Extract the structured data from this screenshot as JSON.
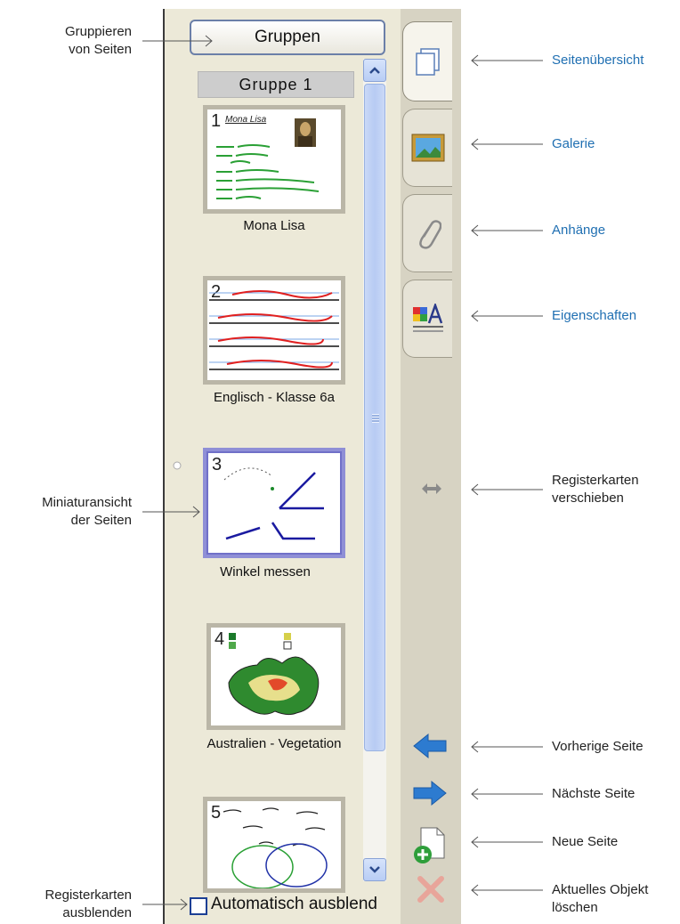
{
  "groups_button": {
    "label": "Gruppen"
  },
  "group_header": {
    "label": "Gruppe 1"
  },
  "pages": [
    {
      "number": "1",
      "title": "Mona Lisa",
      "heading": "Mona Lisa"
    },
    {
      "number": "2",
      "title": "Englisch - Klasse 6a"
    },
    {
      "number": "3",
      "title": "Winkel messen"
    },
    {
      "number": "4",
      "title": "Australien - Vegetation"
    },
    {
      "number": "5",
      "title": ""
    }
  ],
  "tabs": [
    {
      "name": "page-sorter",
      "icon": "pages-icon"
    },
    {
      "name": "gallery",
      "icon": "picture-icon"
    },
    {
      "name": "attachments",
      "icon": "paperclip-icon"
    },
    {
      "name": "properties",
      "icon": "properties-icon"
    }
  ],
  "autohide": {
    "label": "Automatisch ausblend",
    "checked": false
  },
  "annotations": {
    "group_pages": "Gruppieren\nvon Seiten",
    "thumbnails": "Miniaturansicht\nder Seiten",
    "hide_tabs": "Registerkarten\nausblenden",
    "page_sorter": "Seitenübersicht",
    "gallery": "Galerie",
    "attachments": "Anhänge",
    "properties": "Eigenschaften",
    "move_tabs": "Registerkarten\nverschieben",
    "prev_page": "Vorherige Seite",
    "next_page": "Nächste Seite",
    "new_page": "Neue Seite",
    "delete_object": "Aktuelles Objekt\nlöschen"
  },
  "colors": {
    "link_blue": "#1f6fb2",
    "arrow_blue": "#2d7bd0",
    "delete_red": "#e8a59a"
  }
}
